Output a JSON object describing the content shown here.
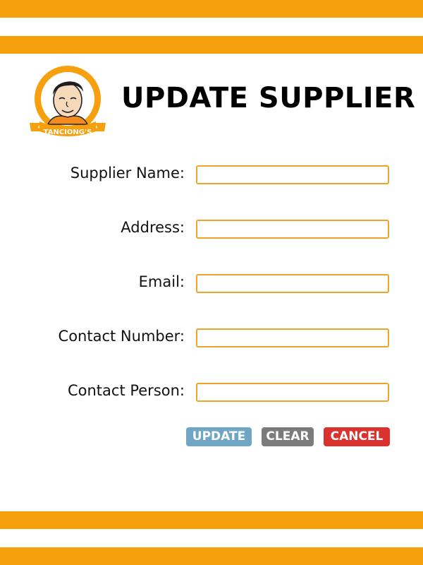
{
  "header": {
    "logo_text": "TANCIONG'S",
    "title": "UPDATE SUPPLIER"
  },
  "form": {
    "fields": [
      {
        "label": "Supplier Name:",
        "value": "",
        "placeholder": ""
      },
      {
        "label": "Address:",
        "value": "",
        "placeholder": ""
      },
      {
        "label": "Email:",
        "value": "",
        "placeholder": ""
      },
      {
        "label": "Contact Number:",
        "value": "",
        "placeholder": ""
      },
      {
        "label": "Contact Person:",
        "value": "",
        "placeholder": ""
      }
    ]
  },
  "buttons": {
    "update_label": "UPDATE",
    "clear_label": "CLEAR",
    "cancel_label": "CANCEL"
  },
  "colors": {
    "accent": "#f5a00c",
    "input_border": "#f0a324",
    "update": "#6fa6c6",
    "clear": "#7b7b7b",
    "cancel": "#d9322f"
  },
  "icons": {
    "logo": "tanciong-logo-icon"
  }
}
